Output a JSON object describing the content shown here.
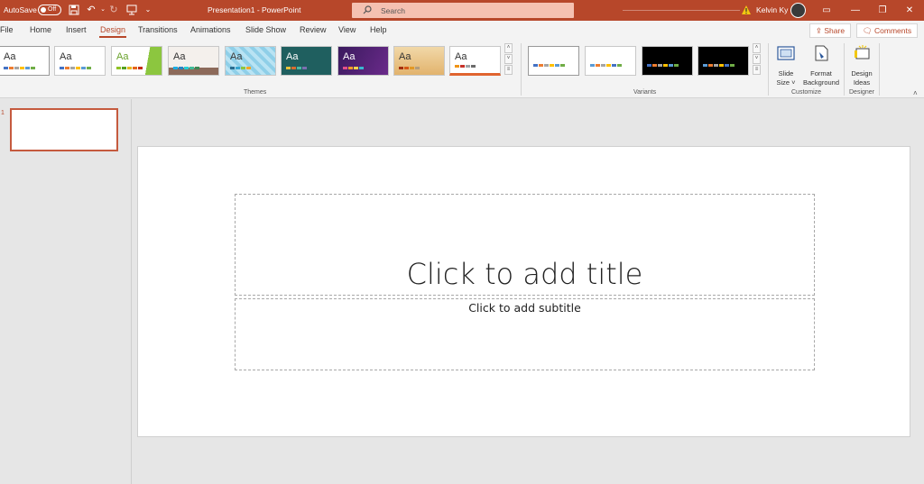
{
  "titlebar": {
    "autosave_label": "AutoSave",
    "autosave_state": "Off",
    "document_title": "Presentation1  -  PowerPoint",
    "search_placeholder": "Search",
    "user_name": "Kelvin Ky",
    "accent_color": "#b7472a"
  },
  "menu": {
    "tabs": [
      {
        "label": "File"
      },
      {
        "label": "Home"
      },
      {
        "label": "Insert"
      },
      {
        "label": "Design"
      },
      {
        "label": "Transitions"
      },
      {
        "label": "Animations"
      },
      {
        "label": "Slide Show"
      },
      {
        "label": "Review"
      },
      {
        "label": "View"
      },
      {
        "label": "Help"
      }
    ],
    "active_tab": "Design",
    "share_label": "Share",
    "comments_label": "Comments"
  },
  "ribbon": {
    "themes_group_label": "Themes",
    "theme_preview_text": "Aa",
    "variants_group_label": "Variants",
    "customize_group_label": "Customize",
    "designer_group_label": "Designer",
    "slide_size_label_1": "Slide",
    "slide_size_label_2": "Size",
    "format_bg_label_1": "Format",
    "format_bg_label_2": "Background",
    "design_ideas_label_1": "Design",
    "design_ideas_label_2": "Ideas"
  },
  "slide_panel": {
    "slide_number": "1"
  },
  "slide": {
    "title_placeholder": "Click to add title",
    "subtitle_placeholder": "Click to add subtitle"
  }
}
